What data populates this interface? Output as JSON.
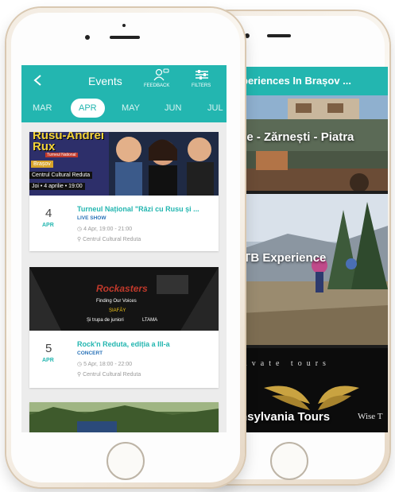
{
  "back_screen": {
    "header_title": "periences In Brașov ...",
    "tiles": [
      {
        "label": "ce - Zărnești - Piatra"
      },
      {
        "label": "ITB Experience"
      },
      {
        "label": "nsylvania Tours",
        "top_text": "ivate tours",
        "brand_text": "Wise T"
      }
    ]
  },
  "header": {
    "title": "Events",
    "feedback_label": "FEEDBACK",
    "filters_label": "FILTERS"
  },
  "months": [
    "MAR",
    "APR",
    "MAY",
    "JUN",
    "JUL"
  ],
  "active_month": "APR",
  "events": [
    {
      "day": "4",
      "month": "APR",
      "title": "Turneul Național \"Râzi cu Rusu și ...",
      "type": "LIVE SHOW",
      "time": "4 Apr, 19:00 - 21:00",
      "venue": "Centrul Cultural Reduta",
      "poster": {
        "headline": "Rusu-Andrei Rux",
        "subline": "Turneul National",
        "city": "Brașov",
        "place": "Centrul Cultural Reduta",
        "date": "Joi • 4 aprilie • 19:00"
      }
    },
    {
      "day": "5",
      "month": "APR",
      "title": "Rock'n Reduta, ediția a III-a",
      "type": "CONCERT",
      "time": "5 Apr, 18:00 - 22:00",
      "venue": "Centrul Cultural Reduta",
      "poster": {
        "headline": "Rockasters",
        "line1": "Finding Our Voices",
        "line2": "ȘIAFĂY",
        "line3": "Și trupa de juniori",
        "line4": "LTAMA"
      }
    }
  ]
}
